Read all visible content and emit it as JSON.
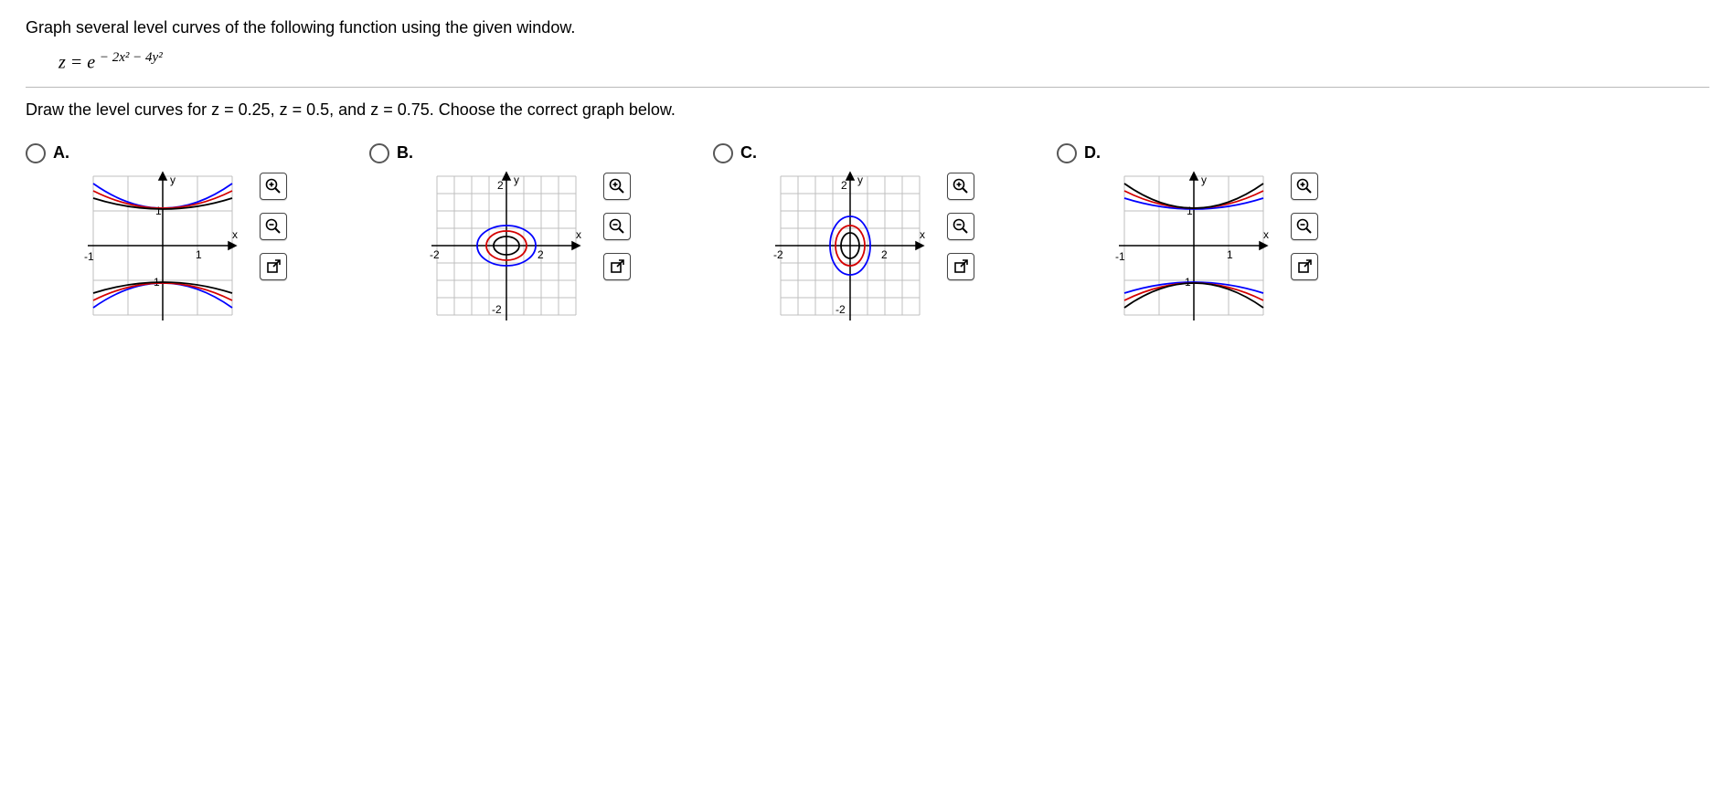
{
  "question": {
    "prompt": "Graph several level curves of the following function using the given window.",
    "equation_lhs": "z = e",
    "equation_exp": " − 2x² − 4y²",
    "subprompt": "Draw the level curves for z = 0.25, z = 0.5, and z = 0.75. Choose the correct graph below."
  },
  "options": {
    "A": {
      "label": "A.",
      "x_range": [
        -1,
        1
      ],
      "y_range": [
        -1,
        1
      ],
      "xlabel": "x",
      "ylabel": "y",
      "type": "hyperbola_vertical"
    },
    "B": {
      "label": "B.",
      "x_range": [
        -2,
        2
      ],
      "y_range": [
        -2,
        2
      ],
      "xlabel": "x",
      "ylabel": "y",
      "type": "ellipse_wide"
    },
    "C": {
      "label": "C.",
      "x_range": [
        -2,
        2
      ],
      "y_range": [
        -2,
        2
      ],
      "xlabel": "x",
      "ylabel": "y",
      "type": "ellipse_tall"
    },
    "D": {
      "label": "D.",
      "x_range": [
        -1,
        1
      ],
      "y_range": [
        -1,
        1
      ],
      "xlabel": "x",
      "ylabel": "y",
      "type": "hyperbola_horizontal"
    }
  },
  "chart_data": {
    "level_values": [
      0.25,
      0.5,
      0.75
    ],
    "colors": {
      "0.25": "#0000ff",
      "0.5": "#d40000",
      "0.75": "#000000"
    }
  }
}
